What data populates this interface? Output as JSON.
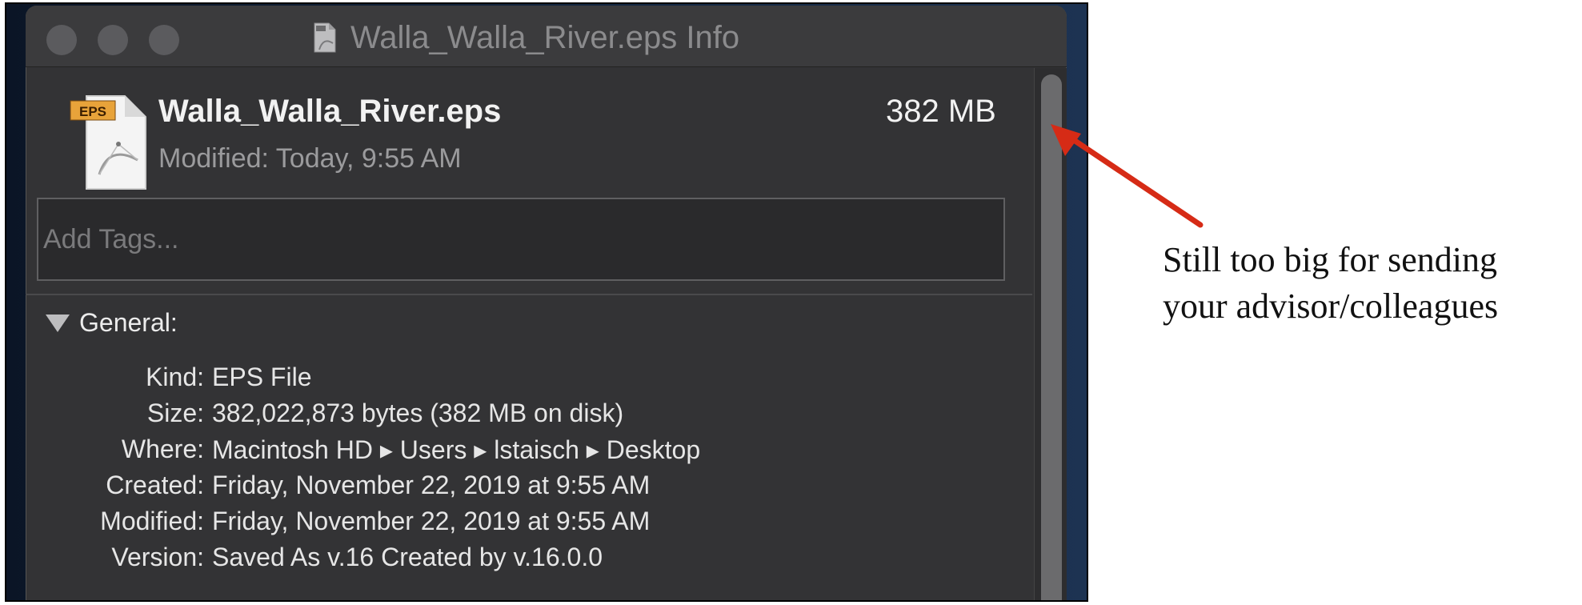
{
  "window": {
    "title": "Walla_Walla_River.eps Info"
  },
  "header": {
    "file_name": "Walla_Walla_River.eps",
    "file_size": "382 MB",
    "modified": "Modified: Today, 9:55 AM",
    "icon_badge": "EPS"
  },
  "tags": {
    "placeholder": "Add Tags..."
  },
  "general": {
    "title": "General:",
    "rows": [
      {
        "label": "Kind:",
        "value": "EPS File"
      },
      {
        "label": "Size:",
        "value": "382,022,873 bytes (382 MB on disk)"
      },
      {
        "label": "Where:",
        "value": "Macintosh HD ▸ Users ▸ lstaisch ▸ Desktop"
      },
      {
        "label": "Created:",
        "value": "Friday, November 22, 2019 at 9:55 AM"
      },
      {
        "label": "Modified:",
        "value": "Friday, November 22, 2019 at 9:55 AM"
      },
      {
        "label": "Version:",
        "value": "Saved As v.16 Created by v.16.0.0"
      }
    ]
  },
  "annotation": {
    "line1": "Still too big for sending",
    "line2": "your advisor/colleagues",
    "arrow_color": "#d62b16"
  },
  "colors": {
    "window_bg": "#333335",
    "titlebar_bg": "#3b3b3d",
    "text_primary": "#f2f2f2",
    "text_secondary": "#9b9b9d"
  }
}
